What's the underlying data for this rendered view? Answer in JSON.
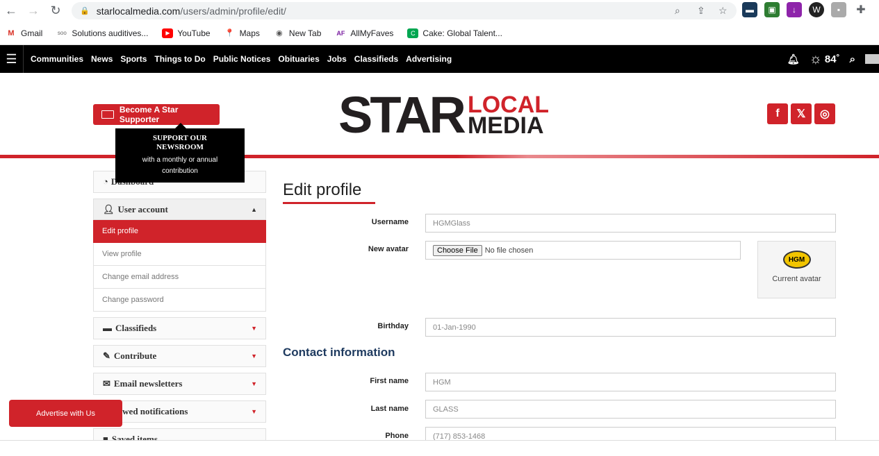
{
  "browser": {
    "url_domain": "starlocalmedia.com",
    "url_path": "/users/admin/profile/edit/",
    "bookmarks": [
      {
        "label": "Gmail",
        "icon": "gmail-icon"
      },
      {
        "label": "Solutions auditives...",
        "icon": "soon-icon"
      },
      {
        "label": "YouTube",
        "icon": "youtube-icon"
      },
      {
        "label": "Maps",
        "icon": "maps-icon"
      },
      {
        "label": "New Tab",
        "icon": "globe-icon"
      },
      {
        "label": "AllMyFaves",
        "icon": "allmyfaves-icon"
      },
      {
        "label": "Cake: Global Talent...",
        "icon": "cake-icon"
      }
    ]
  },
  "sitenav": {
    "links": [
      "Communities",
      "News",
      "Sports",
      "Things to Do",
      "Public Notices",
      "Obituaries",
      "Jobs",
      "Classifieds",
      "Advertising"
    ],
    "temperature": "84˚"
  },
  "header": {
    "support_button": "Become A Star Supporter",
    "tooltip_title": "SUPPORT OUR NEWSROOM",
    "tooltip_text": "with a monthly or annual contribution",
    "logo_star": "STAR",
    "logo_local": "LOCAL",
    "logo_media": "MEDIA"
  },
  "sidebar": {
    "dashboard": "Dashboard",
    "user_account": "User account",
    "sub_items": [
      "Edit profile",
      "View profile",
      "Change email address",
      "Change password"
    ],
    "classifieds": "Classifieds",
    "contribute": "Contribute",
    "email_newsletters": "Email newsletters",
    "followed_notifications": "Followed notifications",
    "saved_items": "Saved items"
  },
  "main": {
    "title": "Edit profile",
    "username_label": "Username",
    "username_value": "HGMGlass",
    "avatar_label": "New avatar",
    "choose_file": "Choose File",
    "no_file": "No file chosen",
    "current_avatar": "Current avatar",
    "avatar_text": "HGM",
    "birthday_label": "Birthday",
    "birthday_value": "01-Jan-1990",
    "contact_title": "Contact information",
    "first_name_label": "First name",
    "first_name_value": "HGM",
    "last_name_label": "Last name",
    "last_name_value": "GLASS",
    "phone_label": "Phone",
    "phone_value": "(717) 853-1468"
  },
  "advertise_button": "Advertise with Us",
  "colors": {
    "accent": "#d0232a",
    "nav_bg": "#000000",
    "heading_blue": "#1e3a5f"
  }
}
